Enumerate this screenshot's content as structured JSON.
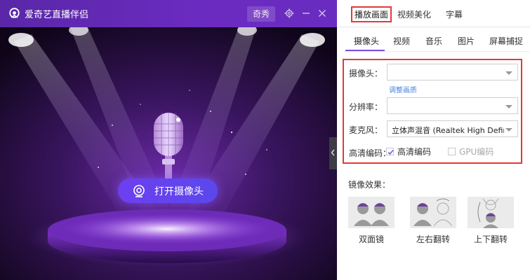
{
  "app": {
    "title": "爱奇艺直播伴侣",
    "show_label": "奇秀"
  },
  "stage": {
    "open_camera_label": "打开摄像头"
  },
  "main_tabs": [
    {
      "label": "播放画面",
      "active": true
    },
    {
      "label": "视频美化",
      "active": false
    },
    {
      "label": "字幕",
      "active": false
    }
  ],
  "sub_tabs": [
    {
      "label": "摄像头",
      "active": true
    },
    {
      "label": "视频",
      "active": false
    },
    {
      "label": "音乐",
      "active": false
    },
    {
      "label": "图片",
      "active": false
    },
    {
      "label": "屏幕捕捉",
      "active": false
    }
  ],
  "device": {
    "camera_label": "摄像头：",
    "camera_value": "",
    "adjust_link": "调整画质",
    "resolution_label": "分辨率：",
    "resolution_value": "",
    "mic_label": "麦克风：",
    "mic_value": "立体声混音 (Realtek High Defin...",
    "hd_label": "高清编码：",
    "hd_check_label": "高清编码",
    "hd_checked": true,
    "gpu_check_label": "GPU编码",
    "gpu_checked": false
  },
  "mirror": {
    "title": "镜像效果：",
    "options": [
      {
        "label": "双面镜"
      },
      {
        "label": "左右翻转"
      },
      {
        "label": "上下翻转"
      }
    ]
  },
  "colors": {
    "accent_purple": "#7b4ee0",
    "highlight_red": "#e23a3a",
    "link_blue": "#4a86d8"
  }
}
